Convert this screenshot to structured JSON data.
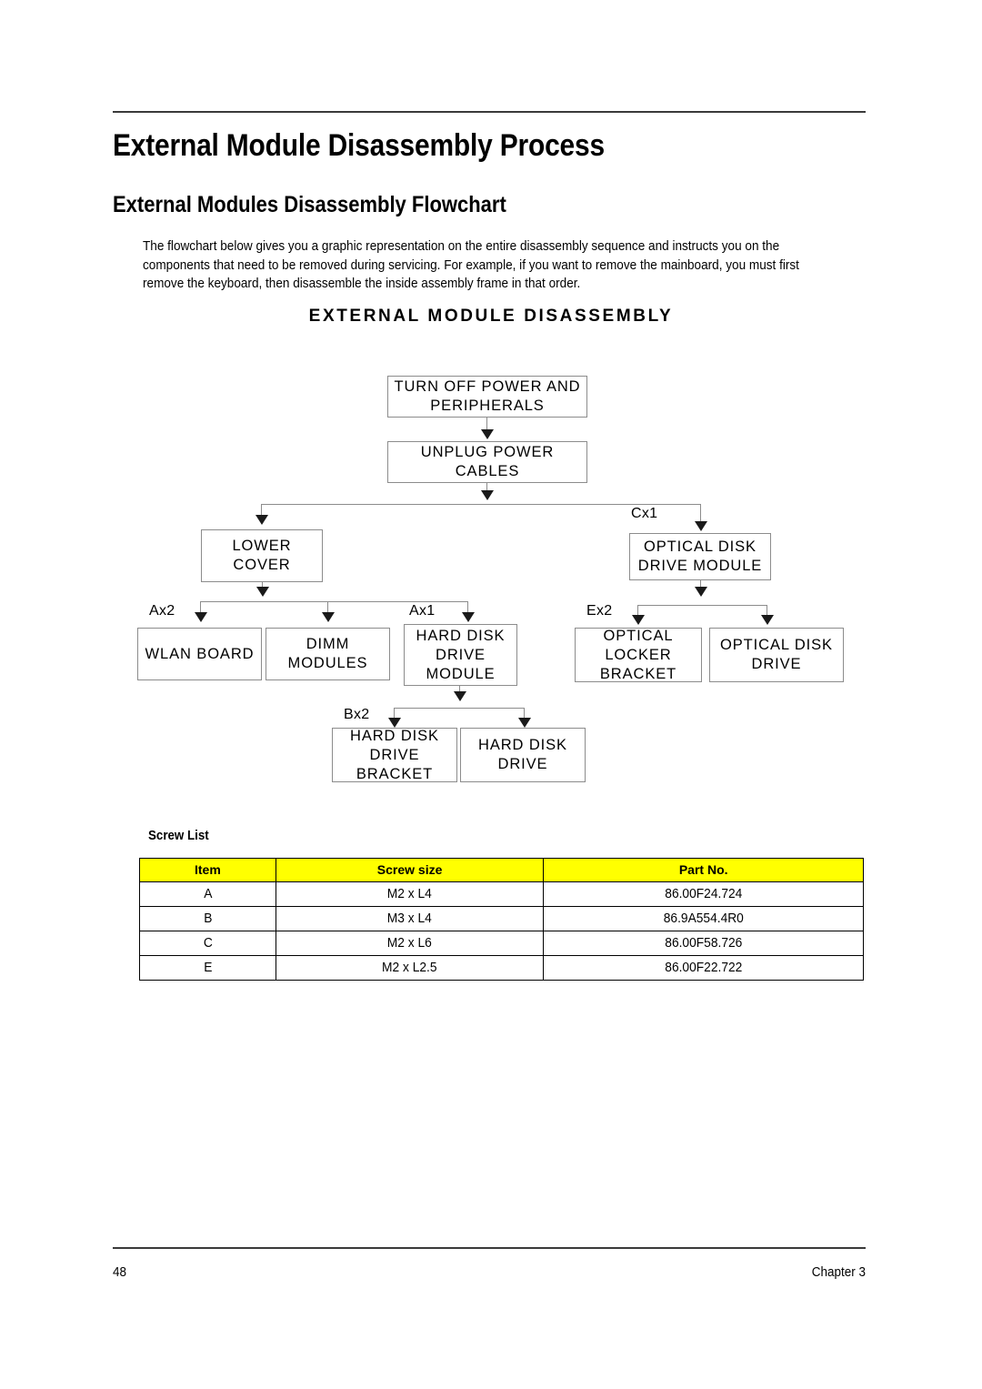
{
  "document": {
    "page_number": "48",
    "chapter": "Chapter 3",
    "heading1": "External Module Disassembly Process",
    "heading2": "External Modules Disassembly Flowchart",
    "paragraph": "The flowchart below gives you a graphic representation on the entire disassembly sequence and instructs you on the components that need to be removed during servicing. For example, if you want to remove the mainboard, you must first remove the keyboard, then disassemble the inside assembly frame in that order."
  },
  "flowchart": {
    "title": "EXTERNAL MODULE DISASSEMBLY",
    "nodes": {
      "turn_off_power": "TURN OFF POWER AND PERIPHERALS",
      "unplug_power": "UNPLUG POWER CABLES",
      "lower_cover": "LOWER COVER",
      "optical_disk_drive_module": "OPTICAL DISK DRIVE MODULE",
      "wlan_board": "WLAN BOARD",
      "dimm_modules": "DIMM MODULES",
      "hard_disk_drive_module": "HARD DISK DRIVE MODULE",
      "optical_locker_bracket": "OPTICAL LOCKER BRACKET",
      "optical_disk_drive": "OPTICAL DISK DRIVE",
      "hard_disk_drive_bracket": "HARD DISK DRIVE BRACKET",
      "hard_disk_drive": "HARD DISK DRIVE"
    },
    "screw_tags": {
      "cx1": "Cx1",
      "ax2": "Ax2",
      "ax1": "Ax1",
      "ex2": "Ex2",
      "bx2": "Bx2"
    }
  },
  "screw_list": {
    "label": "Screw List",
    "header_bg": "#ffff00",
    "columns": [
      "Item",
      "Screw size",
      "Part No."
    ],
    "rows": [
      [
        "A",
        "M2 x L4",
        "86.00F24.724"
      ],
      [
        "B",
        "M3 x L4",
        "86.9A554.4R0"
      ],
      [
        "C",
        "M2 x L6",
        "86.00F58.726"
      ],
      [
        "E",
        "M2 x L2.5",
        "86.00F22.722"
      ]
    ]
  }
}
